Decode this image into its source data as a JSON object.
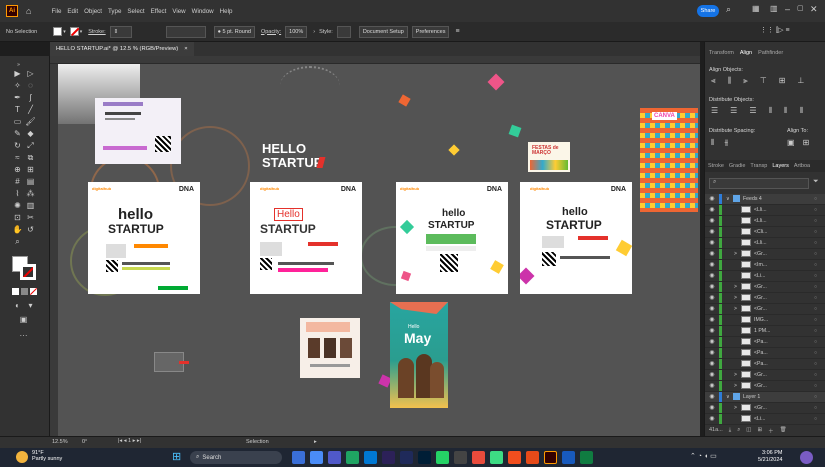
{
  "menubar": {
    "app_badge": "Ai",
    "items": [
      "File",
      "Edit",
      "Object",
      "Type",
      "Select",
      "Effect",
      "View",
      "Window",
      "Help"
    ],
    "share_label": "Share"
  },
  "control_bar": {
    "selection": "No Selection",
    "stroke_label": "Stroke:",
    "brush": "5 pt. Round",
    "opacity_label": "Opacity:",
    "opacity_value": "100%",
    "style_label": "Style:",
    "document_setup": "Document Setup",
    "preferences": "Preferences"
  },
  "document_tab": {
    "title": "HELLO STARTUP.ai* @ 12.5 % (RGB/Preview)",
    "close": "×"
  },
  "canvas": {
    "hello_title_line1": "HELLO",
    "hello_title_line2": "STARTUP",
    "artboards": {
      "dna": "DNA",
      "digitalhub": "digitalhub",
      "hello": "hello",
      "startup": "STARTUP",
      "hello_caps": "Hello",
      "may": "May",
      "festas": "FESTAS de MARÇO",
      "canva": "CANVA"
    }
  },
  "right_panel": {
    "top_tabs": [
      "Transform",
      "Align",
      "Pathfinder"
    ],
    "align_objects": "Align Objects:",
    "distribute_objects": "Distribute Objects:",
    "distribute_spacing": "Distribute Spacing:",
    "align_to": "Align To:",
    "layer_tabs": [
      "Stroke",
      "Gradie",
      "Transp",
      "Layers",
      "Artboa"
    ],
    "layers": [
      {
        "name": "Feeds 4",
        "expand": "∨"
      },
      {
        "name": "<Lli...",
        "expand": ""
      },
      {
        "name": "<Lli...",
        "expand": ""
      },
      {
        "name": "<Cli...",
        "expand": ""
      },
      {
        "name": "<Lli...",
        "expand": ""
      },
      {
        "name": "<Gr...",
        "expand": ">"
      },
      {
        "name": "<Im...",
        "expand": ""
      },
      {
        "name": "<Li...",
        "expand": ""
      },
      {
        "name": "<Gr...",
        "expand": ">"
      },
      {
        "name": "<Gr...",
        "expand": ">"
      },
      {
        "name": "<Gr...",
        "expand": ">"
      },
      {
        "name": "IMG...",
        "expand": ""
      },
      {
        "name": "1 PM...",
        "expand": ""
      },
      {
        "name": "<Pa...",
        "expand": ""
      },
      {
        "name": "<Pa...",
        "expand": ""
      },
      {
        "name": "<Pa...",
        "expand": ""
      },
      {
        "name": "<Gr...",
        "expand": ">"
      },
      {
        "name": "<Gr...",
        "expand": ">"
      },
      {
        "name": "Layer 1",
        "expand": "∨"
      },
      {
        "name": "<Gr...",
        "expand": ">"
      },
      {
        "name": "<Li...",
        "expand": ""
      }
    ],
    "footer": "41a..."
  },
  "status_bar": {
    "zoom": "12.5%",
    "angle": "0°",
    "page": "1",
    "tool": "Selection"
  },
  "taskbar": {
    "temperature": "91°F",
    "weather": "Partly sunny",
    "search_placeholder": "Search",
    "time": "3:06 PM",
    "date": "5/21/2024"
  },
  "colors": {
    "accent": "#1473e6",
    "ai_orange": "#ff9a00",
    "brand_red": "#e4312b",
    "panel_bg": "#323232",
    "canvas_bg": "#535353"
  }
}
